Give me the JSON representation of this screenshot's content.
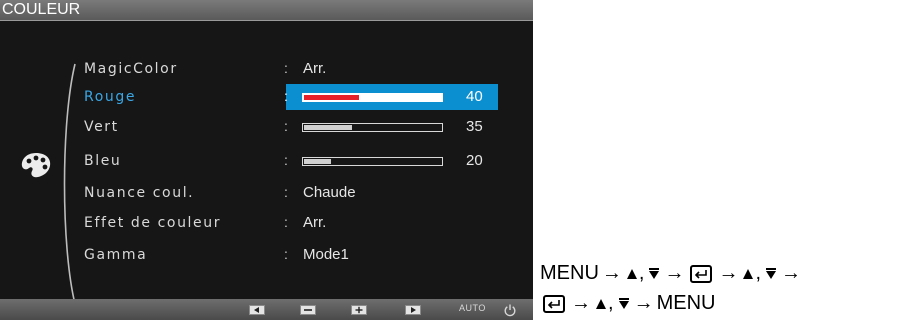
{
  "osd": {
    "title": "COULEUR",
    "category_icon": "palette-icon",
    "menu": [
      {
        "label": "MagicColor",
        "value": "Arr.",
        "type": "text",
        "active": false
      },
      {
        "label": "Rouge",
        "value": "40",
        "type": "bar",
        "level_percent": 40,
        "active": true
      },
      {
        "label": "Vert",
        "value": "35",
        "type": "bar",
        "level_percent": 35,
        "active": false
      },
      {
        "label": "Bleu",
        "value": "20",
        "type": "bar",
        "level_percent": 20,
        "active": false
      },
      {
        "label": "Nuance coul.",
        "value": "Chaude",
        "type": "text",
        "active": false
      },
      {
        "label": "Effet de couleur",
        "value": "Arr.",
        "type": "text",
        "active": false
      },
      {
        "label": "Gamma",
        "value": "Mode1",
        "type": "text",
        "active": false
      }
    ],
    "separator": ":",
    "bottom_keys": [
      {
        "icon": "left-arrow-icon"
      },
      {
        "icon": "minus-icon"
      },
      {
        "icon": "plus-icon"
      },
      {
        "icon": "right-arrow-icon"
      }
    ],
    "auto_label": "AUTO",
    "power_icon": "power-icon",
    "colors": {
      "highlight": "#0c8fd1",
      "active_text": "#3aa7e6",
      "active_bar_fill": "#e8202a",
      "background": "#161616"
    }
  },
  "instructions": {
    "menu": "MENU",
    "arrow": "→",
    "comma": ",",
    "up_icon": "up-triangle-icon",
    "down_icon": "down-triangle-icon",
    "enter_icon": "enter-key-icon"
  }
}
